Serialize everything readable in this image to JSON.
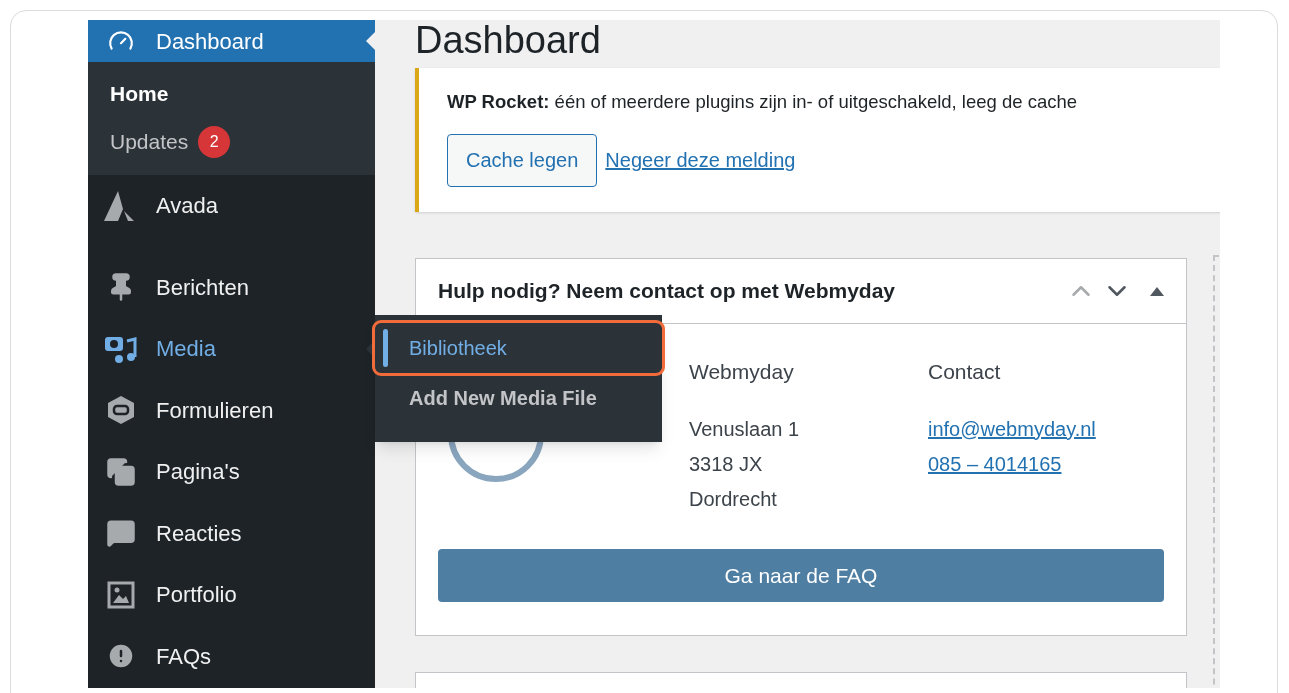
{
  "sidebar": {
    "items": [
      {
        "label": "Dashboard",
        "selected": true,
        "hovered": false,
        "children": [
          {
            "label": "Home",
            "selected": true
          },
          {
            "label": "Updates",
            "selected": false,
            "badge": "2"
          }
        ]
      },
      {
        "label": "Avada",
        "selected": false,
        "hovered": false
      },
      {
        "label": "Berichten",
        "selected": false,
        "hovered": false
      },
      {
        "label": "Media",
        "selected": false,
        "hovered": true
      },
      {
        "label": "Formulieren",
        "selected": false,
        "hovered": false
      },
      {
        "label": "Pagina's",
        "selected": false,
        "hovered": false
      },
      {
        "label": "Reacties",
        "selected": false,
        "hovered": false
      },
      {
        "label": "Portfolio",
        "selected": false,
        "hovered": false
      },
      {
        "label": "FAQs",
        "selected": false,
        "hovered": false
      }
    ]
  },
  "flyout": {
    "items": [
      {
        "label": "Bibliotheek",
        "selected": true,
        "highlighted": true
      },
      {
        "label": "Add New Media File",
        "selected": false,
        "highlighted": false
      }
    ]
  },
  "page": {
    "title": "Dashboard"
  },
  "notice": {
    "text": "**WP Rocket:** één of meerdere plugins zijn in- of uitgeschakeld, leeg de cache",
    "button": "Cache legen",
    "link": "Negeer deze melding"
  },
  "widget": {
    "title": "Hulp nodig? Neem contact op met Webmyday",
    "columns": [
      {
        "heading": "Webmyday",
        "lines": [
          {
            "text": "Venuslaan 1",
            "link": false
          },
          {
            "text": "3318 JX",
            "link": false
          },
          {
            "text": "Dordrecht",
            "link": false
          }
        ]
      },
      {
        "heading": "Contact",
        "lines": [
          {
            "text": "info@webmyday.nl",
            "link": true
          },
          {
            "text": "085 – 4014165",
            "link": true
          }
        ]
      }
    ],
    "button": "Ga naar de FAQ"
  }
}
